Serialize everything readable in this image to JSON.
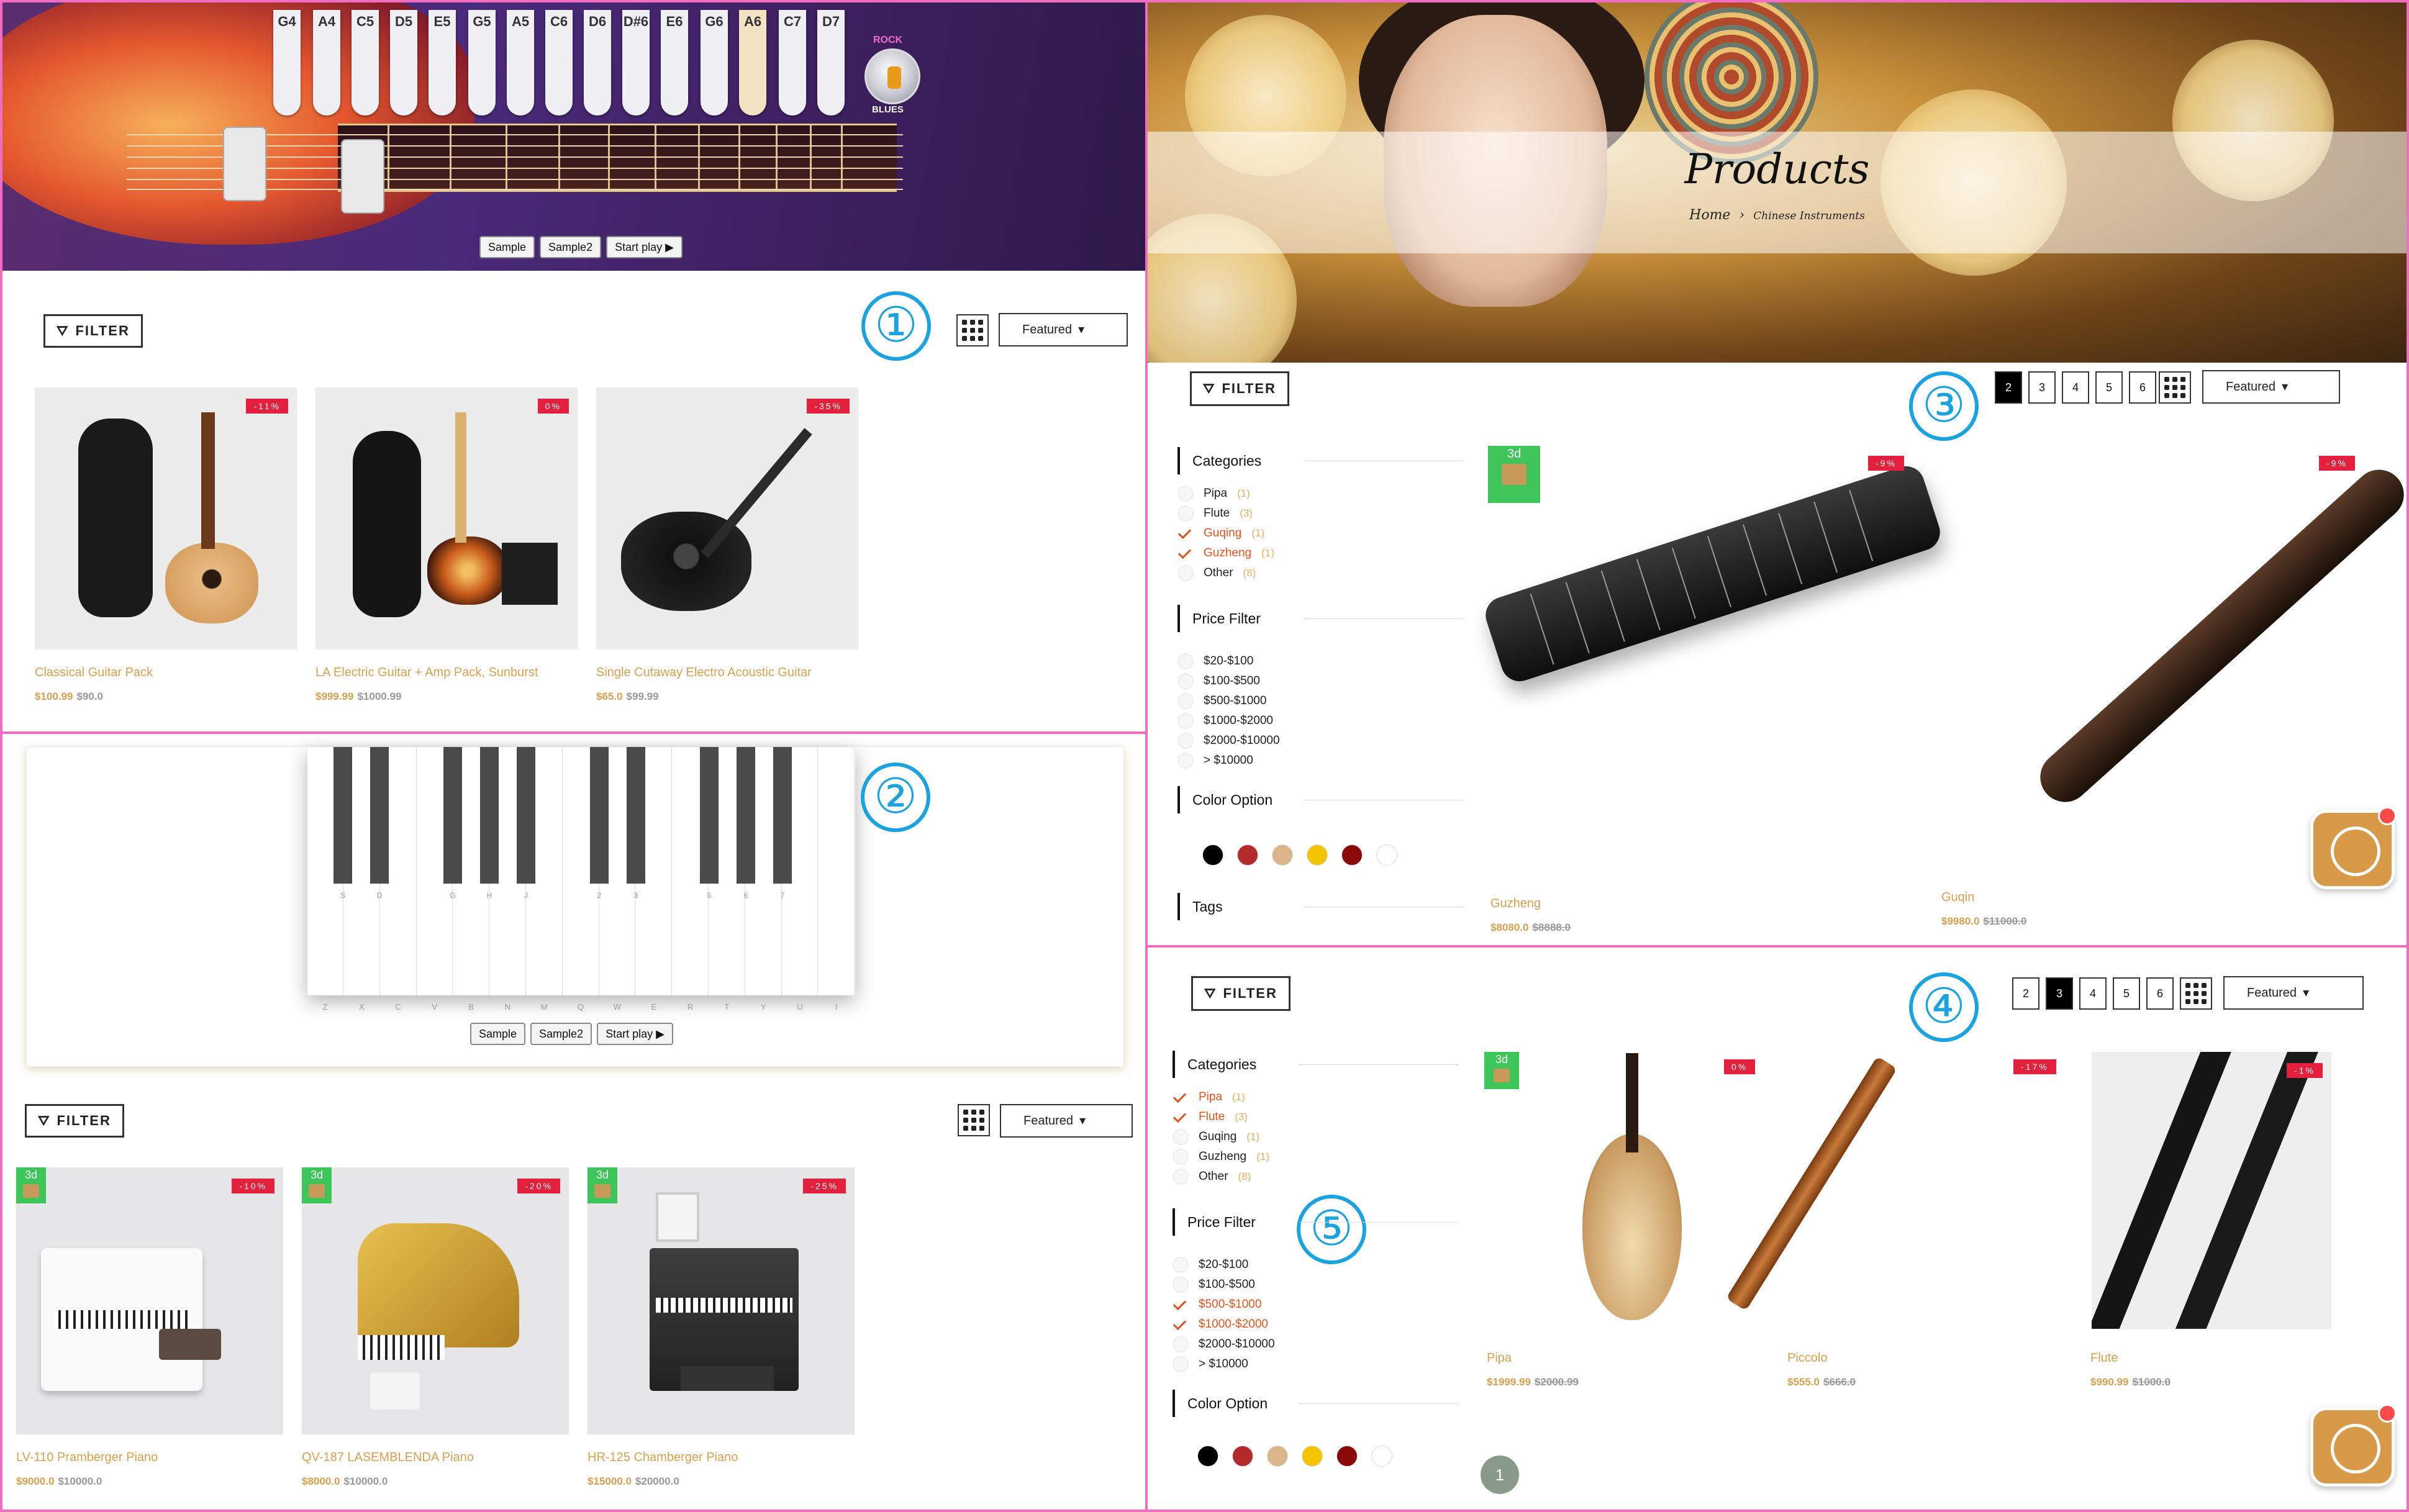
{
  "panel1": {
    "hero": {
      "keys": [
        "G4",
        "A4",
        "C5",
        "D5",
        "E5",
        "G5",
        "A5",
        "C6",
        "D6",
        "D#6",
        "E6",
        "G6",
        "A6",
        "C7",
        "D7"
      ],
      "knob_top": "ROCK",
      "knob_bottom": "BLUES",
      "buttons": [
        "Sample",
        "Sample2",
        "Start play ▶"
      ]
    },
    "filter_label": "FILTER",
    "sort_label": "Featured",
    "annotation": "①",
    "products": [
      {
        "name": "Classical Guitar Pack",
        "price": "$100.99",
        "old": "$90.0",
        "badge": "-11%"
      },
      {
        "name": "LA Electric Guitar + Amp Pack, Sunburst",
        "price": "$999.99",
        "old": "$1000.99",
        "badge": "0%"
      },
      {
        "name": "Single Cutaway Electro Acoustic Guitar",
        "price": "$65.0",
        "old": "$99.99",
        "badge": "-35%"
      }
    ]
  },
  "panel2": {
    "keyboard": {
      "white_letters": [
        "Z",
        "X",
        "C",
        "V",
        "B",
        "N",
        "M",
        "Q",
        "W",
        "E",
        "R",
        "T",
        "Y",
        "U",
        "I"
      ],
      "black_letters": [
        "S",
        "D",
        "G",
        "H",
        "J",
        "2",
        "3",
        "5",
        "6",
        "7"
      ],
      "buttons": [
        "Sample",
        "Sample2",
        "Start play ▶"
      ]
    },
    "annotation": "②",
    "filter_label": "FILTER",
    "sort_label": "Featured",
    "badge3d": "3d",
    "products": [
      {
        "name": "LV-110 Pramberger Piano",
        "price": "$9000.0",
        "old": "$10000.0",
        "badge": "-10%"
      },
      {
        "name": "QV-187 LASEMBLENDA Piano",
        "price": "$8000.0",
        "old": "$10000.0",
        "badge": "-20%"
      },
      {
        "name": "HR-125 Chamberger Piano",
        "price": "$15000.0",
        "old": "$20000.0",
        "badge": "-25%"
      }
    ]
  },
  "panel3": {
    "title": "Products",
    "breadcrumb_home": "Home",
    "breadcrumb_sep": "›",
    "breadcrumb_current": "Chinese Instruments",
    "filter_label": "FILTER",
    "sort_label": "Featured",
    "annotation": "③",
    "pages": [
      "2",
      "3",
      "4",
      "5",
      "6"
    ],
    "active_page": "2",
    "sidebar": {
      "categories_title": "Categories",
      "categories": [
        {
          "label": "Pipa",
          "count": "(1)",
          "checked": false
        },
        {
          "label": "Flute",
          "count": "(3)",
          "checked": false
        },
        {
          "label": "Guqing",
          "count": "(1)",
          "checked": true
        },
        {
          "label": "Guzheng",
          "count": "(1)",
          "checked": true
        },
        {
          "label": "Other",
          "count": "(8)",
          "checked": false
        }
      ],
      "price_title": "Price Filter",
      "prices": [
        {
          "label": "$20-$100",
          "checked": false
        },
        {
          "label": "$100-$500",
          "checked": false
        },
        {
          "label": "$500-$1000",
          "checked": false
        },
        {
          "label": "$1000-$2000",
          "checked": false
        },
        {
          "label": "$2000-$10000",
          "checked": false
        },
        {
          "label": "> $10000",
          "checked": false
        }
      ],
      "color_title": "Color Option",
      "colors": [
        "#000000",
        "#b22a2a",
        "#dcb68a",
        "#f2c500",
        "#8a0a0a",
        "#ffffff"
      ],
      "tags_title": "Tags"
    },
    "badge3d": "3d",
    "products": [
      {
        "name": "Guzheng",
        "price": "$8080.0",
        "old": "$8888.0",
        "badge": "-9%"
      },
      {
        "name": "Guqin",
        "price": "$9980.0",
        "old": "$11000.0",
        "badge": "-9%"
      }
    ]
  },
  "panel4": {
    "filter_label": "FILTER",
    "sort_label": "Featured",
    "annotation": "④",
    "annotation2": "⑤",
    "pages": [
      "2",
      "3",
      "4",
      "5",
      "6"
    ],
    "active_page": "3",
    "sidebar": {
      "categories_title": "Categories",
      "categories": [
        {
          "label": "Pipa",
          "count": "(1)",
          "checked": true
        },
        {
          "label": "Flute",
          "count": "(3)",
          "checked": true
        },
        {
          "label": "Guqing",
          "count": "(1)",
          "checked": false
        },
        {
          "label": "Guzheng",
          "count": "(1)",
          "checked": false
        },
        {
          "label": "Other",
          "count": "(8)",
          "checked": false
        }
      ],
      "price_title": "Price Filter",
      "prices": [
        {
          "label": "$20-$100",
          "checked": false
        },
        {
          "label": "$100-$500",
          "checked": false
        },
        {
          "label": "$500-$1000",
          "checked": true
        },
        {
          "label": "$1000-$2000",
          "checked": true
        },
        {
          "label": "$2000-$10000",
          "checked": false
        },
        {
          "label": "> $10000",
          "checked": false
        }
      ],
      "color_title": "Color Option",
      "colors": [
        "#000000",
        "#b22a2a",
        "#dcb68a",
        "#f2c500",
        "#8a0a0a",
        "#ffffff"
      ]
    },
    "badge3d": "3d",
    "page_indicator": "1",
    "products": [
      {
        "name": "Pipa",
        "price": "$1999.99",
        "old": "$2000.99",
        "badge": "0%"
      },
      {
        "name": "Piccolo",
        "price": "$555.0",
        "old": "$666.0",
        "badge": "-17%"
      },
      {
        "name": "Flute",
        "price": "$990.99",
        "old": "$1000.0",
        "badge": "-1%"
      }
    ]
  }
}
